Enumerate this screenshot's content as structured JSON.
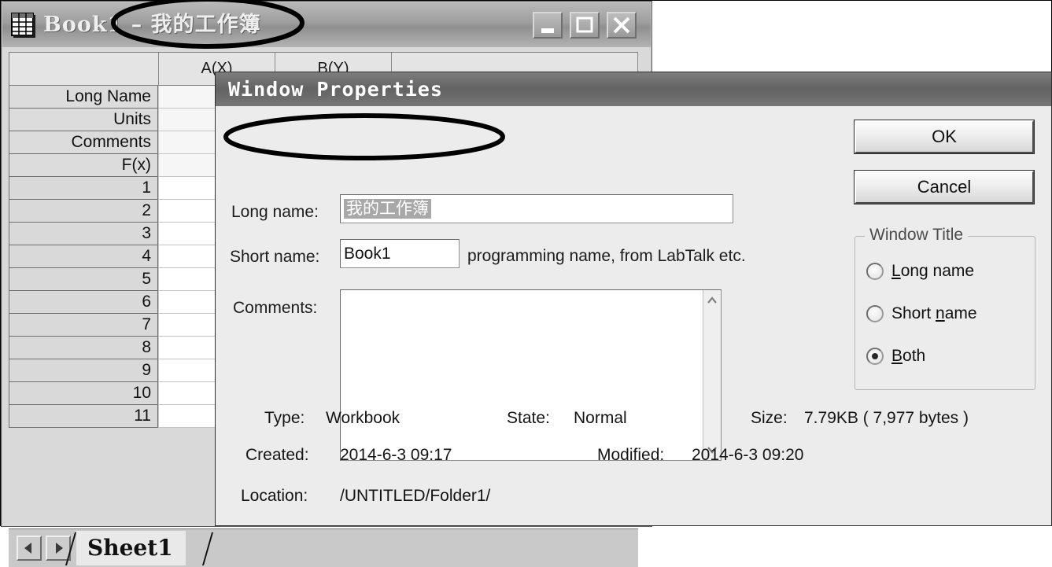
{
  "workbook_window": {
    "icon": "workbook-grid-icon",
    "title": "Book1 – 我的工作簿",
    "short_name": "Book1",
    "long_name": "我的工作簿",
    "window_buttons": {
      "minimize": "minimize-icon",
      "maximize": "maximize-icon",
      "close": "close-icon"
    },
    "grid": {
      "corner_header": "",
      "column_headers": [
        "A(X)",
        "B(Y)",
        ""
      ],
      "meta_rows": [
        "Long Name",
        "Units",
        "Comments",
        "F(x)"
      ],
      "data_rows": [
        "1",
        "2",
        "3",
        "4",
        "5",
        "6",
        "7",
        "8",
        "9",
        "10",
        "11"
      ]
    },
    "tabbar": {
      "prev_label": "◀",
      "next_label": "▶",
      "sheet_tab": "Sheet1"
    }
  },
  "dialog": {
    "title": "Window Properties",
    "long_name": {
      "label": "Long name:",
      "value": "我的工作簿",
      "selected": true
    },
    "short_name": {
      "label": "Short name:",
      "value": "Book1",
      "hint": "programming name, from LabTalk etc."
    },
    "comments": {
      "label": "Comments:",
      "value": "",
      "scroll_up": "⌃",
      "scroll_down": "⌄"
    },
    "buttons": {
      "ok": "OK",
      "cancel": "Cancel"
    },
    "window_title_group": {
      "legend": "Window Title",
      "options": [
        {
          "label": "Long name",
          "mnemonic": "L",
          "rest": "ong name",
          "selected": false
        },
        {
          "label": "Short name",
          "mnemonic": "n",
          "pre": "Short ",
          "rest": "ame",
          "selected": false
        },
        {
          "label": "Both",
          "mnemonic": "B",
          "rest": "oth",
          "selected": true
        }
      ]
    },
    "info": {
      "type_label": "Type:",
      "type_value": "Workbook",
      "state_label": "State:",
      "state_value": "Normal",
      "size_label": "Size:",
      "size_value": "7.79KB ( 7,977 bytes )",
      "created_label": "Created:",
      "created_value": "2014-6-3 09:17",
      "modified_label": "Modified:",
      "modified_value": "2014-6-3 09:20",
      "location_label": "Location:",
      "location_value": "/UNTITLED/Folder1/"
    }
  },
  "annotations": [
    {
      "name": "title-ellipse",
      "target": "window title long name"
    },
    {
      "name": "longname-ellipse",
      "target": "Long name field"
    }
  ],
  "colors": {
    "dialog_face": "#ececec",
    "window_face": "#c6c6c6",
    "titlebar": "#8f8f8f",
    "selection": "#a8a8a8",
    "annotation": "#000000"
  }
}
